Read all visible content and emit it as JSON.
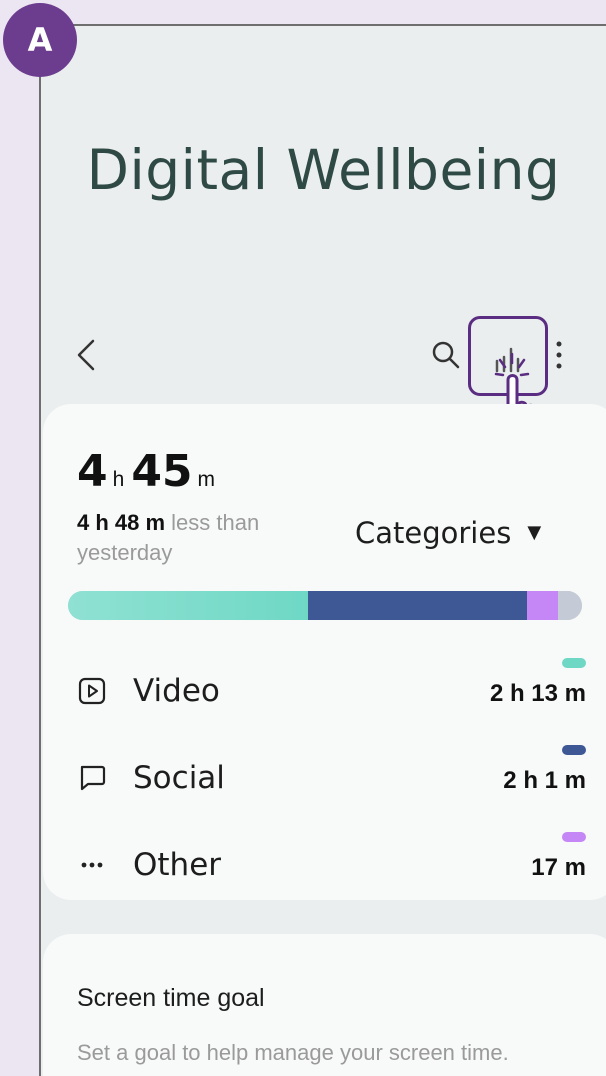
{
  "badge": {
    "label": "A"
  },
  "app": {
    "title": "Digital Wellbeing"
  },
  "topbar": {
    "icons": [
      "back-icon",
      "search-icon",
      "bar-chart-icon",
      "more-icon"
    ],
    "highlight_color": "#5b2d82"
  },
  "summary": {
    "total_hours": "4",
    "hours_unit": "h",
    "total_minutes": "45",
    "minutes_unit": "m",
    "compare_value": "4 h 48 m",
    "compare_text": " less than yesterday",
    "dropdown_label": "Categories"
  },
  "usage": {
    "segments": [
      {
        "name": "Video",
        "share": 0.467,
        "color": "#7ddbcc"
      },
      {
        "name": "Social",
        "share": 0.426,
        "color": "#3e5795"
      },
      {
        "name": "Other",
        "share": 0.06,
        "color": "#c487f5"
      },
      {
        "name": "Remainder",
        "share": 0.047,
        "color": "#c4cad6"
      }
    ]
  },
  "categories": [
    {
      "label": "Video",
      "value": "2 h 13 m",
      "icon": "video-icon",
      "color": "#6fd8c5"
    },
    {
      "label": "Social",
      "value": "2 h 1 m",
      "icon": "chat-icon",
      "color": "#3e5795"
    },
    {
      "label": "Other",
      "value": "17 m",
      "icon": "more-horizontal-icon",
      "color": "#c487f5"
    }
  ],
  "goal": {
    "title": "Screen time goal",
    "description": "Set a goal to help manage your screen time."
  }
}
